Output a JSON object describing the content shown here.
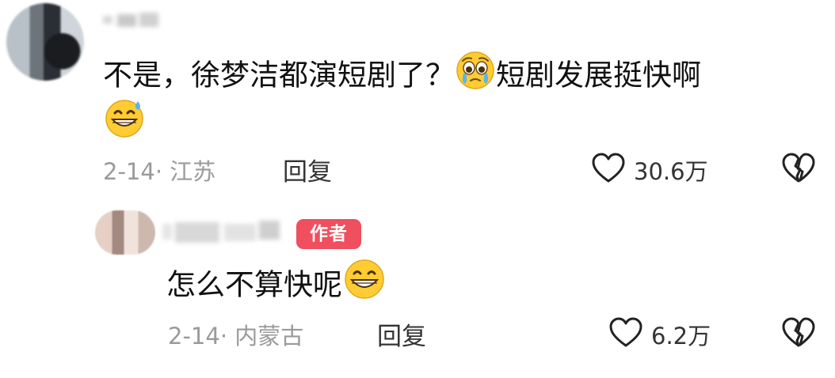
{
  "comments": [
    {
      "text_line1_part1": "不是，徐梦洁都演短剧了？",
      "emoji1": "crying-face-emoji",
      "text_line1_part2": "短剧发展挺快啊",
      "emoji2": "grinning-sweat-emoji",
      "date_location": "2-14· 江苏",
      "reply_label": "回复",
      "like_count": "30.6万"
    },
    {
      "author_badge": "作者",
      "text": "怎么不算快呢",
      "emoji": "grinning-face-emoji",
      "date_location": "2-14· 内蒙古",
      "reply_label": "回复",
      "like_count": "6.2万"
    }
  ],
  "colors": {
    "badge": "#ef4f5f",
    "meta_text": "#9a9a9a",
    "emoji_yellow": "#ffcc33"
  },
  "icons": [
    "heart-outline-icon",
    "broken-heart-icon"
  ]
}
